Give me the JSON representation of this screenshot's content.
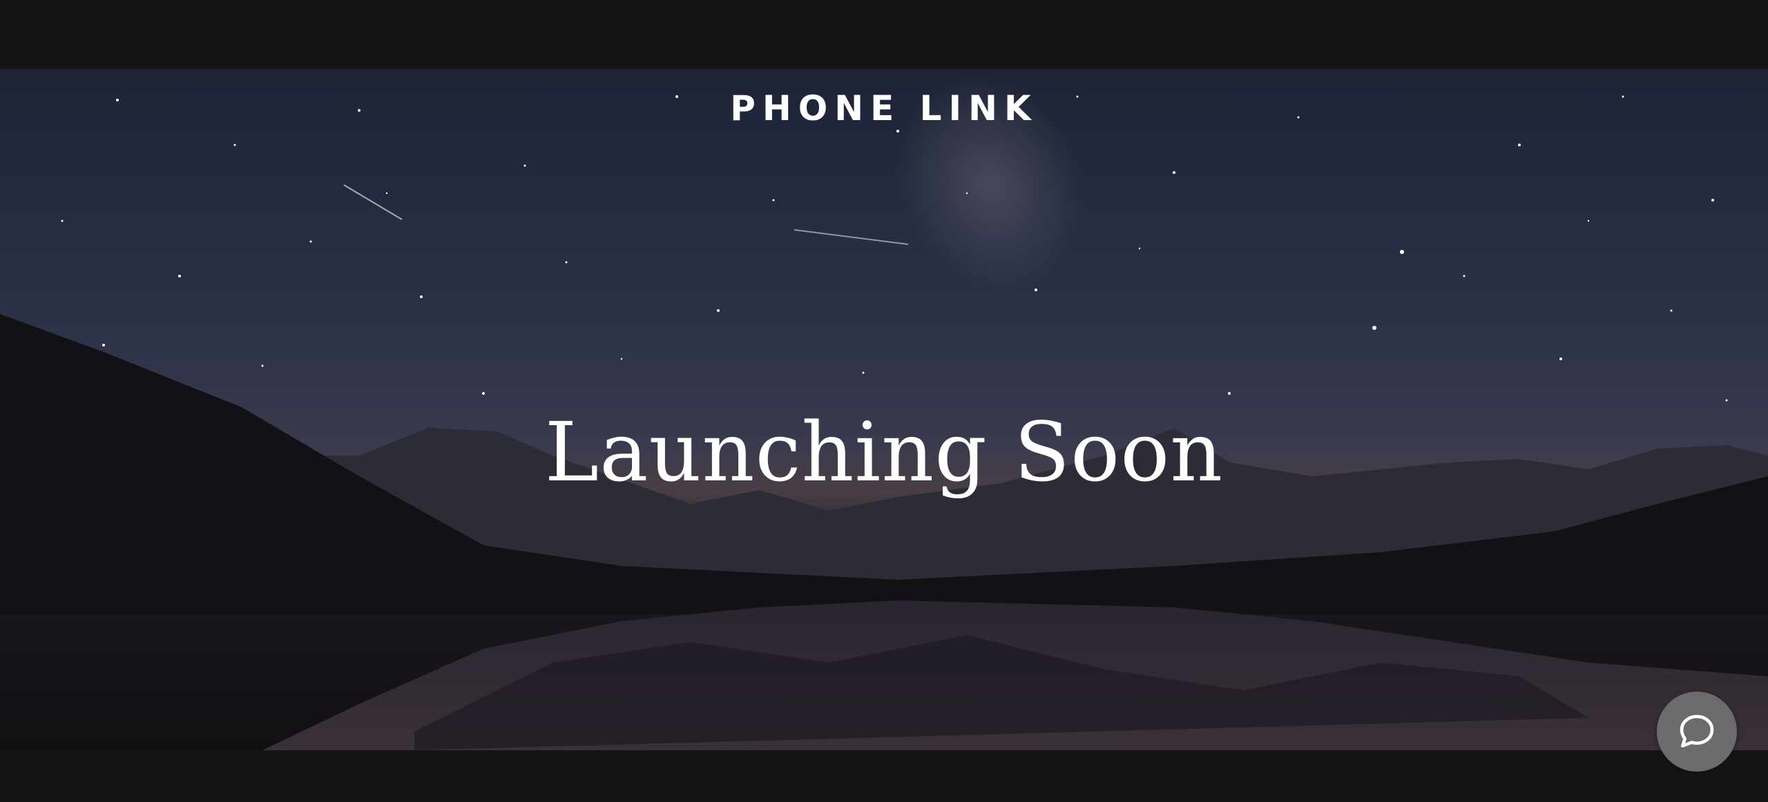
{
  "header": {
    "brand": "PHONE LINK"
  },
  "hero": {
    "headline": "Launching Soon"
  },
  "chat_widget": {
    "icon": "chat-bubble-icon"
  },
  "colors": {
    "bar_background": "#151515",
    "sky_top": "#1e2436",
    "text": "#ffffff",
    "chat_button": "#6b6b6b"
  }
}
